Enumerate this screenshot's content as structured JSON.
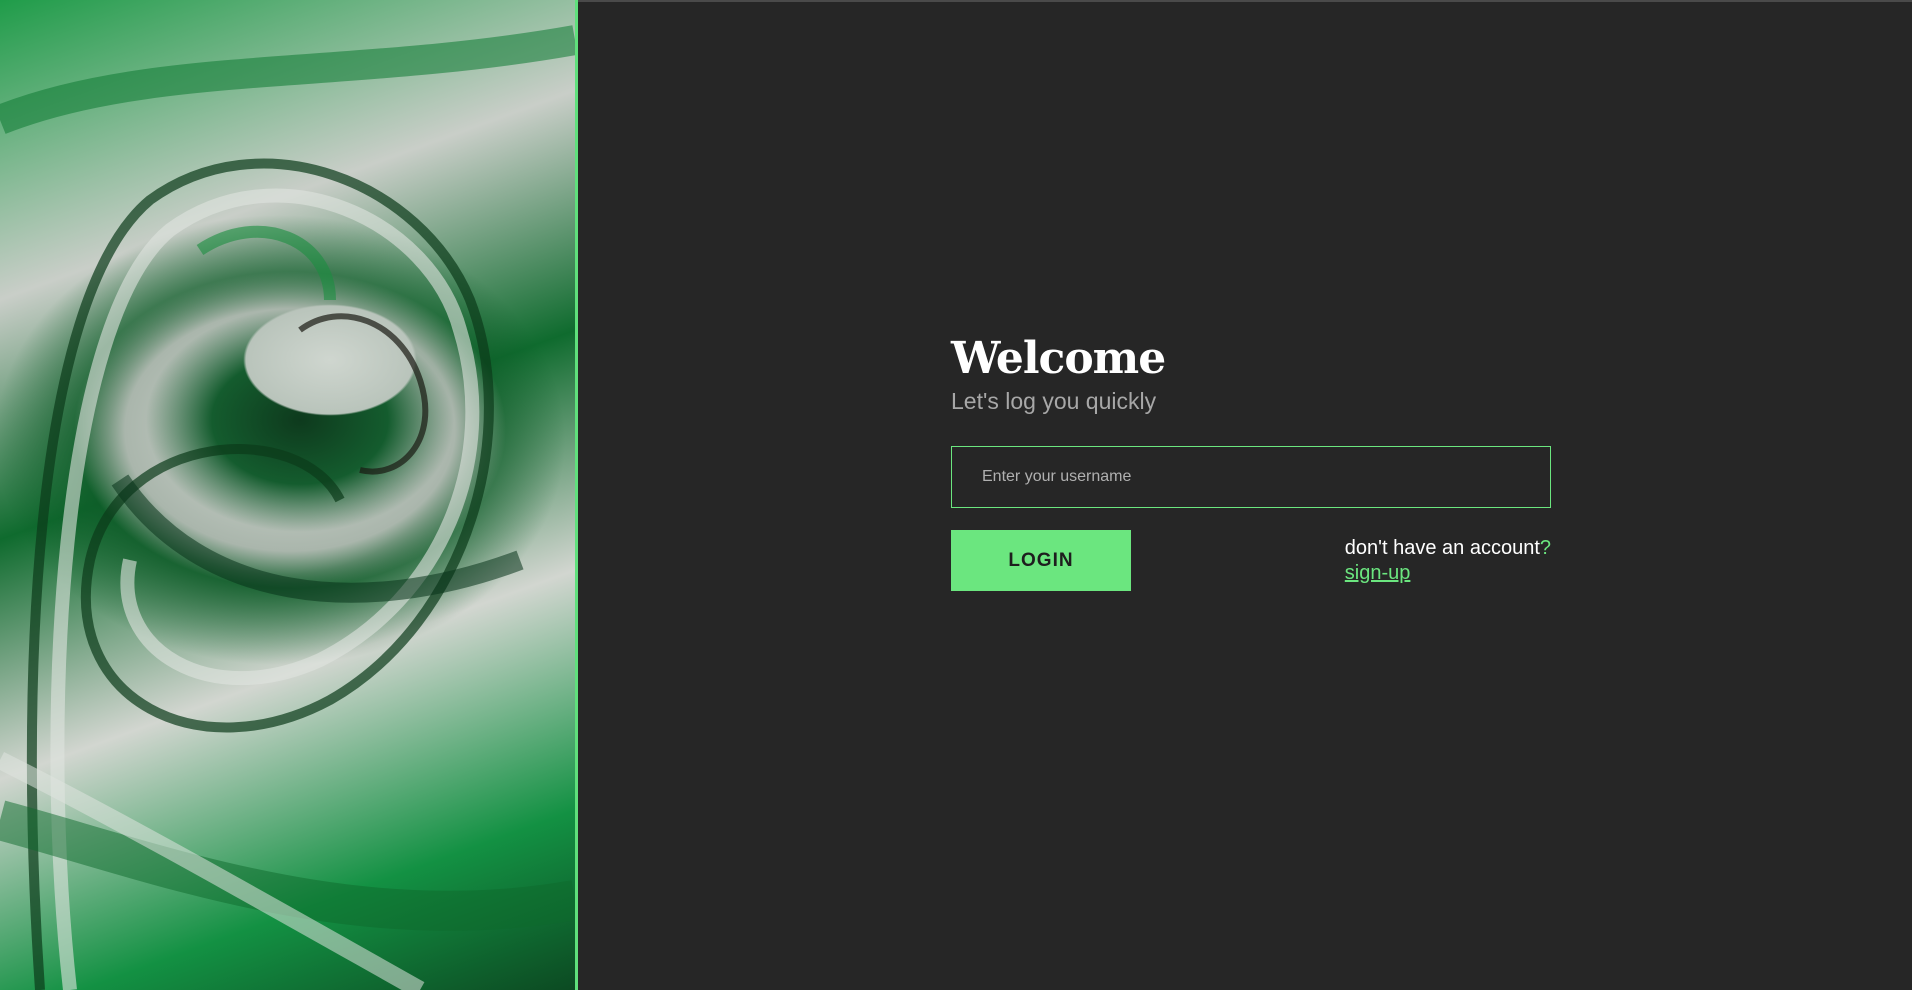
{
  "form": {
    "title": "Welcome",
    "subtitle": "Let's log you quickly",
    "username_placeholder": "Enter your username",
    "username_value": "",
    "login_label": "LOGIN",
    "no_account_text": "don't have an account",
    "no_account_punct": "?",
    "signup_label": "sign-up"
  },
  "colors": {
    "background": "#262626",
    "accent": "#6be67f",
    "title": "#ffffff",
    "subtitle": "#a7a7a7"
  },
  "icons": {
    "art": "green-marble-abstract-image"
  }
}
